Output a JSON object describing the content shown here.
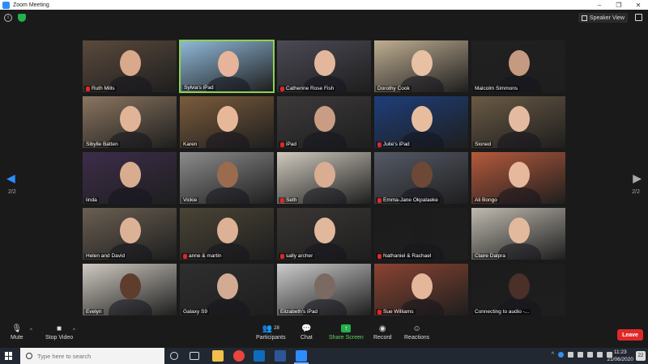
{
  "window": {
    "title": "Zoom Meeting",
    "controls": [
      "–",
      "❐",
      "✕"
    ]
  },
  "meeting": {
    "speaker_view_label": "Speaker View",
    "page_left": "2/2",
    "page_right": "2/2",
    "participants": [
      {
        "name": "Ruth Mills",
        "muted": true,
        "bg": "#5a4a3c",
        "skin": "#d9a98c"
      },
      {
        "name": "Sylvia's iPad",
        "muted": false,
        "active": true,
        "bg": "#8fb8d8",
        "skin": "#e5b49a"
      },
      {
        "name": "Catherine Rose Fish",
        "muted": true,
        "bg": "#4b4a55",
        "skin": "#e2b79b"
      },
      {
        "name": "Dorothy Cook",
        "muted": false,
        "bg": "#bfae92",
        "skin": "#e8c0a4"
      },
      {
        "name": "Malcolm Simmons",
        "muted": false,
        "bg": "#202020",
        "skin": "#c49a80"
      },
      {
        "name": "Sibylle Batten",
        "muted": false,
        "bg": "#8a7560",
        "skin": "#e0b497"
      },
      {
        "name": "Karen",
        "muted": false,
        "bg": "#7c5c3c",
        "skin": "#e6b899"
      },
      {
        "name": "iPad",
        "muted": true,
        "bg": "#3d3a3a",
        "skin": "#c99d83"
      },
      {
        "name": "Julie's iPad",
        "muted": true,
        "bg": "#1e3e7a",
        "skin": "#e8bd9e"
      },
      {
        "name": "Sioned",
        "muted": false,
        "bg": "#6a5a45",
        "skin": "#e4bba0"
      },
      {
        "name": "linda",
        "muted": false,
        "bg": "#3d2d4a",
        "skin": "#d8ac8f"
      },
      {
        "name": "Vickie",
        "muted": false,
        "bg": "#8c8c8c",
        "skin": "#9a6b4e"
      },
      {
        "name": "Seth",
        "muted": true,
        "bg": "#d0cabf",
        "skin": "#d9ad92"
      },
      {
        "name": "Emma-Jane Okpalaeke",
        "muted": true,
        "bg": "#555a66",
        "skin": "#6e4836"
      },
      {
        "name": "Ali Bongo",
        "muted": false,
        "bg": "#b65a3c",
        "skin": "#e6b99c"
      },
      {
        "name": "Helen and David",
        "muted": false,
        "bg": "#6a5f52",
        "skin": "#dcb296"
      },
      {
        "name": "anne & martin",
        "muted": true,
        "bg": "#4a4436",
        "skin": "#dcb196"
      },
      {
        "name": "sally archer",
        "muted": true,
        "bg": "#3a3634",
        "skin": "#e1b89c"
      },
      {
        "name": "Nathaniel & Rachael",
        "muted": true,
        "bg": "#1c1c1c",
        "skin": "#1c1c1c"
      },
      {
        "name": "Claire Dalpra",
        "muted": false,
        "bg": "#bfbab0",
        "skin": "#e3b99d"
      },
      {
        "name": "Evelyn",
        "muted": false,
        "bg": "#cfcac2",
        "skin": "#5e3d2c"
      },
      {
        "name": "Galaxy S9",
        "muted": false,
        "bg": "#2f2f2f",
        "skin": "#d3ab92"
      },
      {
        "name": "Elizabeth's iPad",
        "muted": false,
        "bg": "#cccccc",
        "skin": "#7a6a62"
      },
      {
        "name": "Sue Williams",
        "muted": true,
        "bg": "#8a4432",
        "skin": "#e4b79b"
      },
      {
        "name": "Connecting to audio -...",
        "muted": false,
        "bg": "#1c1c1c",
        "skin": "#4a3028"
      }
    ]
  },
  "toolbar": {
    "mute": "Mute",
    "stop_video": "Stop Video",
    "participants": "Participants",
    "participants_count": "28",
    "chat": "Chat",
    "share_screen": "Share Screen",
    "record": "Record",
    "reactions": "Reactions",
    "leave": "Leave"
  },
  "taskbar": {
    "search_placeholder": "Type here to search",
    "time": "11:23",
    "date": "21/06/2020",
    "notifications": "22"
  },
  "colors": {
    "accent": "#2d8cff",
    "leave": "#e02828",
    "share": "#22b14c",
    "active_speaker": "#8fd14f"
  }
}
